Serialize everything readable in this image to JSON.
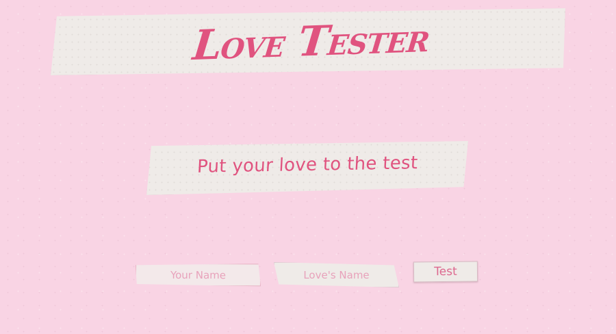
{
  "header": {
    "title_word1_initial": "L",
    "title_word1_rest": "OVE",
    "title_word2_initial": "T",
    "title_word2_rest": "ESTER"
  },
  "subtitle": "Put your love to the test",
  "form": {
    "your_name": {
      "value": "",
      "placeholder": "Your Name"
    },
    "loves_name": {
      "value": "",
      "placeholder": "Love's Name"
    },
    "submit_label": "Test"
  },
  "colors": {
    "background": "#f9d4e4",
    "paper": "#efebe8",
    "accent": "#e0537f"
  }
}
